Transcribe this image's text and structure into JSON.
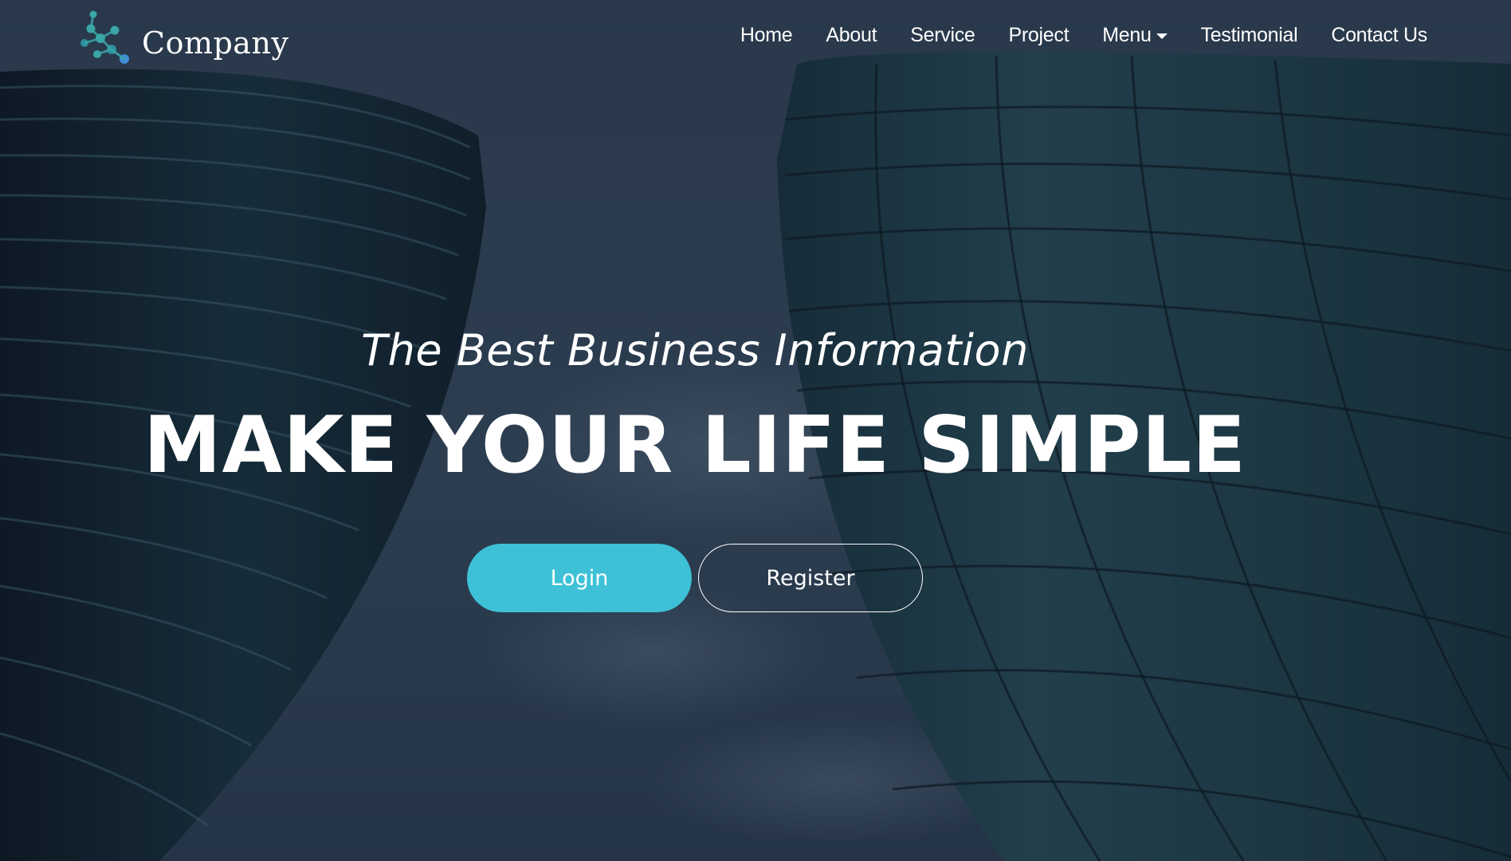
{
  "brand": {
    "name": "Company",
    "logo_icon": "molecule-logo-icon"
  },
  "nav": {
    "items": [
      {
        "label": "Home"
      },
      {
        "label": "About"
      },
      {
        "label": "Service"
      },
      {
        "label": "Project"
      },
      {
        "label": "Menu",
        "has_dropdown": true
      },
      {
        "label": "Testimonial"
      },
      {
        "label": "Contact Us"
      }
    ]
  },
  "hero": {
    "tagline": "The Best Business Information",
    "headline": "MAKE YOUR LIFE SIMPLE",
    "login_label": "Login",
    "register_label": "Register"
  },
  "colors": {
    "accent": "#3ec1d6",
    "logo_teal": "#3aa6a8",
    "logo_blue": "#3f8fd8",
    "text": "#ffffff"
  }
}
